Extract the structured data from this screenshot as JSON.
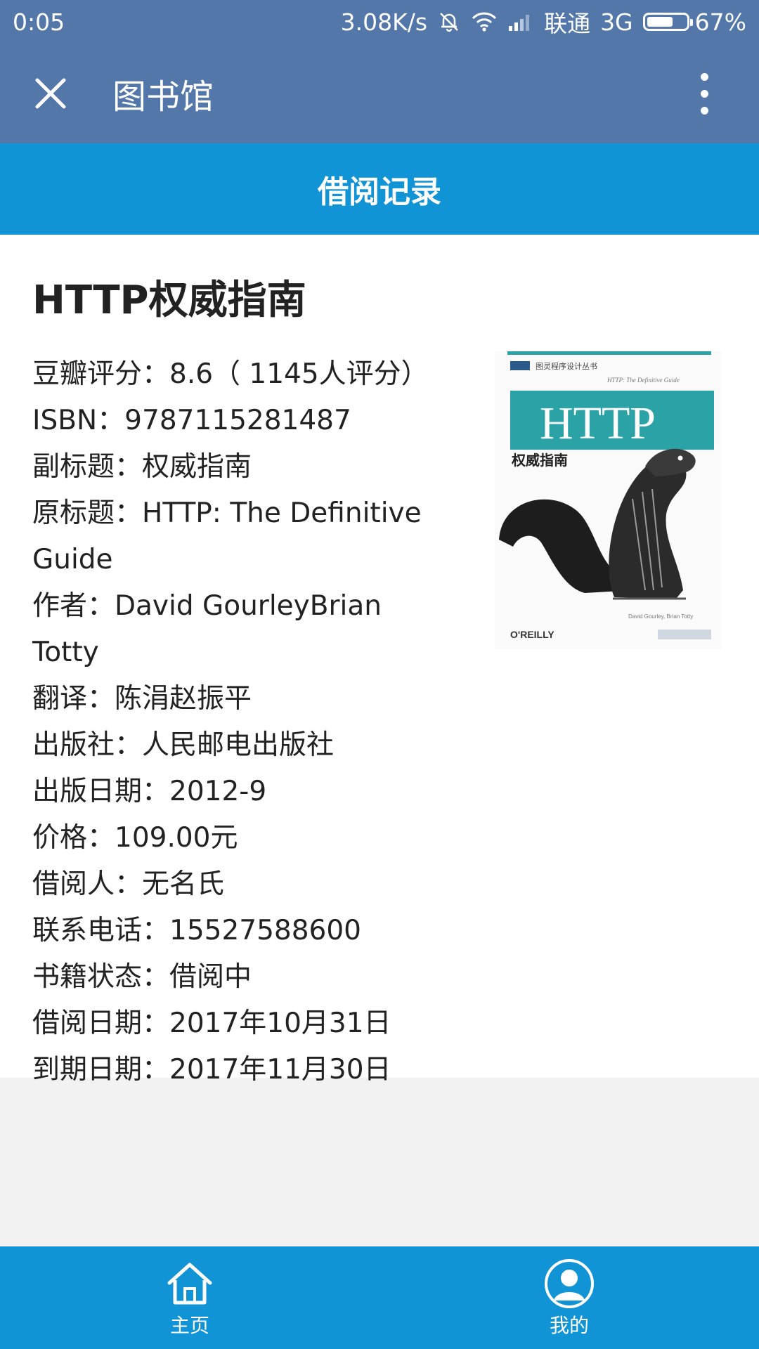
{
  "status_bar": {
    "time": "0:05",
    "speed": "3.08K/s",
    "carrier": "联通",
    "network": "3G",
    "battery": "67%",
    "battery_level": 0.67
  },
  "header": {
    "title": "图书馆",
    "icons": [
      "close-icon",
      "more-vertical-icon"
    ]
  },
  "section": {
    "title": "借阅记录"
  },
  "book": {
    "title": "HTTP权威指南",
    "info": [
      "豆瓣评分：8.6（ 1145人评分）",
      "ISBN：9787115281487",
      "副标题：权威指南",
      "原标题：HTTP: The Definitive Guide",
      "作者：David GourleyBrian Totty",
      "翻译：陈涓赵振平",
      "出版社：人民邮电出版社",
      "出版日期：2012-9",
      "价格：109.00元",
      "借阅人：无名氏",
      "联系电话：15527588600",
      "书籍状态：借阅中",
      "借阅日期：2017年10月31日",
      "到期日期：2017年11月30日"
    ],
    "cover": {
      "series": "图灵程序设计丛书",
      "subtitle_en": "HTTP: The Definitive Guide",
      "word": "HTTP",
      "cn_title": "权威指南",
      "publisher_logo": "O'REILLY",
      "accent_color": "#2aa2a6"
    }
  },
  "tabs": [
    {
      "label": "主页",
      "icon": "home-icon"
    },
    {
      "label": "我的",
      "icon": "user-icon"
    }
  ],
  "colors": {
    "titlebar": "#5277a8",
    "accent": "#1194d6",
    "background": "#f2f2f2"
  }
}
